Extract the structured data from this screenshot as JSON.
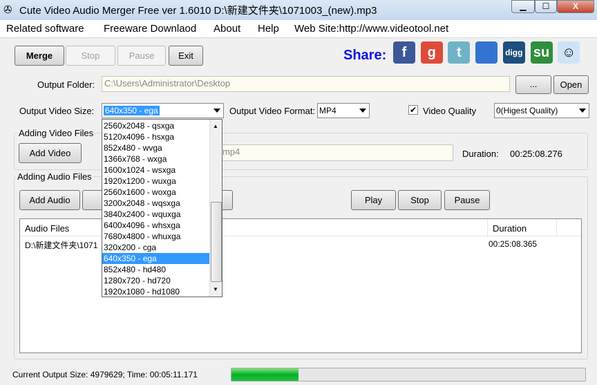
{
  "window": {
    "title": "Cute Video Audio Merger Free  ver 1.6010  D:\\新建文件夹\\1071003_(new).mp3",
    "minimize": "▁",
    "maximize": "☐",
    "close": "X"
  },
  "menu": [
    "Related software",
    "Freeware Downlaod",
    "About",
    "Help",
    "Web Site:http://www.videotool.net"
  ],
  "toolbar": {
    "merge": "Merge",
    "stop": "Stop",
    "pause": "Pause",
    "exit": "Exit"
  },
  "share": {
    "label": "Share:",
    "icons": [
      {
        "name": "facebook-icon",
        "glyph": "f",
        "color": "#3b5998"
      },
      {
        "name": "google-icon",
        "glyph": "g",
        "color": "#dd4b39"
      },
      {
        "name": "twitter-icon",
        "glyph": "t",
        "color": "#6fb3c7"
      },
      {
        "name": "delicious-icon",
        "glyph": "",
        "color": "#3274d0"
      },
      {
        "name": "digg-icon",
        "glyph": "digg",
        "color": "#1d4e7d"
      },
      {
        "name": "stumbleupon-icon",
        "glyph": "su",
        "color": "#2f8f3a"
      },
      {
        "name": "reddit-icon",
        "glyph": "☺",
        "color": "#cee3f8"
      }
    ]
  },
  "output": {
    "folder_label": "Output Folder:",
    "folder": "C:\\Users\\Administrator\\Desktop",
    "browse": "...",
    "open": "Open",
    "size_label": "Output Video Size:",
    "size": "640x350 - ega",
    "format_label": "Output Video Format:",
    "format": "MP4",
    "quality_label": "Video Quality",
    "quality_checked": true,
    "quality": "0(Higest Quality)"
  },
  "size_options": [
    "2560x2048 - qsxga",
    "5120x4096 - hsxga",
    "852x480 - wvga",
    "1366x768 - wxga",
    "1600x1024 - wsxga",
    "1920x1200 - wuxga",
    "2560x1600 - woxga",
    "3200x2048 - wqsxga",
    "3840x2400 - wquxga",
    "6400x4096 - whsxga",
    "7680x4800 - whuxga",
    "320x200 - cga",
    "640x350 - ega",
    "852x480 - hd480",
    "1280x720 - hd720",
    "1920x1080 - hd1080"
  ],
  "video": {
    "group": "Adding Video Files",
    "add": "Add Video",
    "file": "mp4",
    "duration_label": "Duration:",
    "duration": "00:25:08.276"
  },
  "audio": {
    "group": "Adding Audio Files",
    "add": "Add Audio",
    "play": "Play",
    "stop": "Stop",
    "pause": "Pause",
    "columns": [
      "Audio Files",
      "Duration"
    ],
    "rows": [
      {
        "file": "D:\\新建文件夹\\1071",
        "duration": "00:25:08.365"
      }
    ]
  },
  "status": {
    "text": "Current Output Size: 4979629; Time: 00:05:11.171",
    "progress_percent": 19
  }
}
